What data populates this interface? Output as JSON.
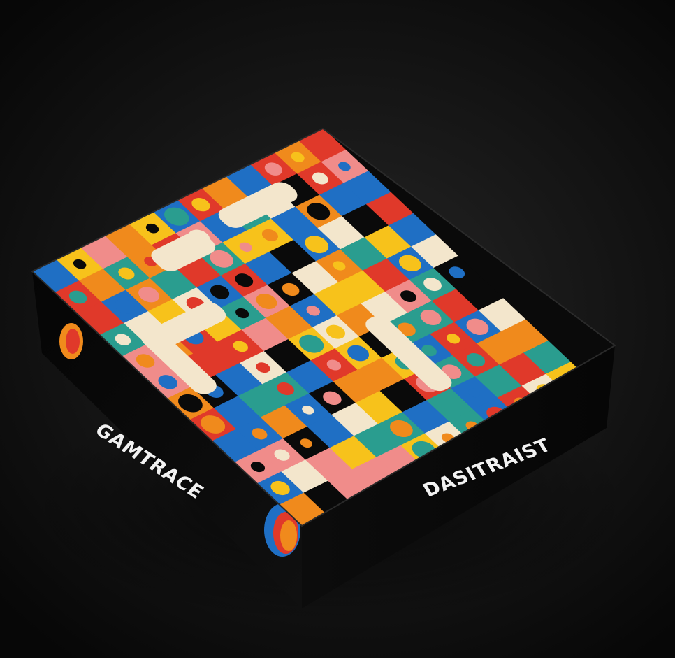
{
  "box": {
    "left_side_title": "GAMTRACE",
    "front_side_title": "DASITRAIST"
  },
  "colors": {
    "background": "#141414",
    "box_black": "#0a0a0a",
    "red": "#e0392a",
    "orange": "#f08a1c",
    "yellow": "#f7c21b",
    "blue": "#1f6fc4",
    "teal": "#2a9d8f",
    "pink": "#f08c8a",
    "cream": "#f3e6cc"
  }
}
